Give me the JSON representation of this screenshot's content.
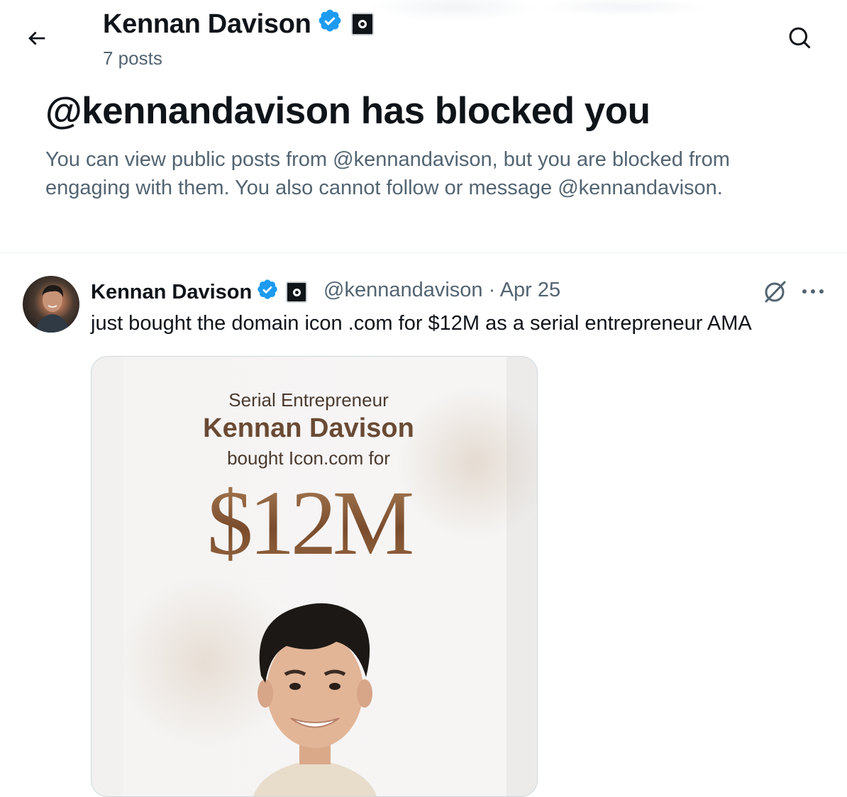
{
  "header": {
    "name": "Kennan Davison",
    "post_count": "7 posts",
    "back_icon": "arrow-left-icon",
    "search_icon": "search-icon"
  },
  "blocked": {
    "title": "@kennandavison has blocked you",
    "description": "You can view public posts from @kennandavison, but you are blocked from engaging with them. You also cannot follow or message @kennandavison."
  },
  "post": {
    "author_name": "Kennan Davison",
    "handle_date": "@kennandavison · Apr 25",
    "text": "just bought the domain icon .com for $12M as a serial entrepreneur AMA",
    "media": {
      "subtitle": "Serial Entrepreneur",
      "name": "Kennan Davison",
      "bought": "bought Icon.com for",
      "price": "$12M"
    }
  },
  "colors": {
    "verified_blue": "#1d9bf0",
    "secondary_text": "#536471",
    "primary_text": "#0f1419"
  }
}
